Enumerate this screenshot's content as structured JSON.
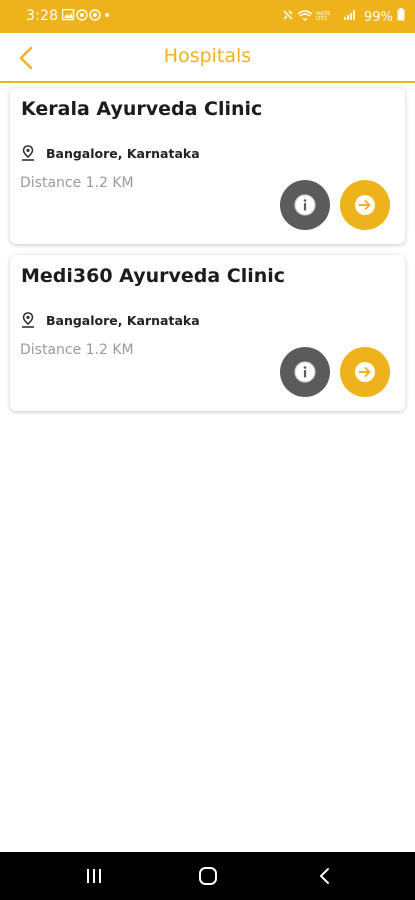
{
  "status_bar": {
    "time": "3:28",
    "battery": "99%",
    "left_icons": [
      "gallery-icon",
      "assistant-icon",
      "assistant-icon",
      "dot-icon"
    ],
    "right_icons": [
      "mute-icon",
      "wifi-icon",
      "volte-icon",
      "signal-icon",
      "battery-icon"
    ],
    "color": "#eeb31b"
  },
  "app_bar": {
    "title": "Hospitals",
    "back_icon": "chevron-left-icon",
    "accent": "#eeb31b"
  },
  "hospitals": [
    {
      "name": "Kerala Ayurveda Clinic",
      "location": "Bangalore, Karnataka",
      "distance": "Distance 1.2 KM"
    },
    {
      "name": "Medi360 Ayurveda Clinic",
      "location": "Bangalore, Karnataka",
      "distance": "Distance 1.2 KM"
    }
  ],
  "card_actions": {
    "info_icon": "info-icon",
    "go_icon": "arrow-right-icon",
    "info_color": "#5b5b5b",
    "go_color": "#eeb31b"
  },
  "nav_bar": {
    "buttons": [
      "recents-icon",
      "home-icon",
      "back-icon"
    ]
  }
}
